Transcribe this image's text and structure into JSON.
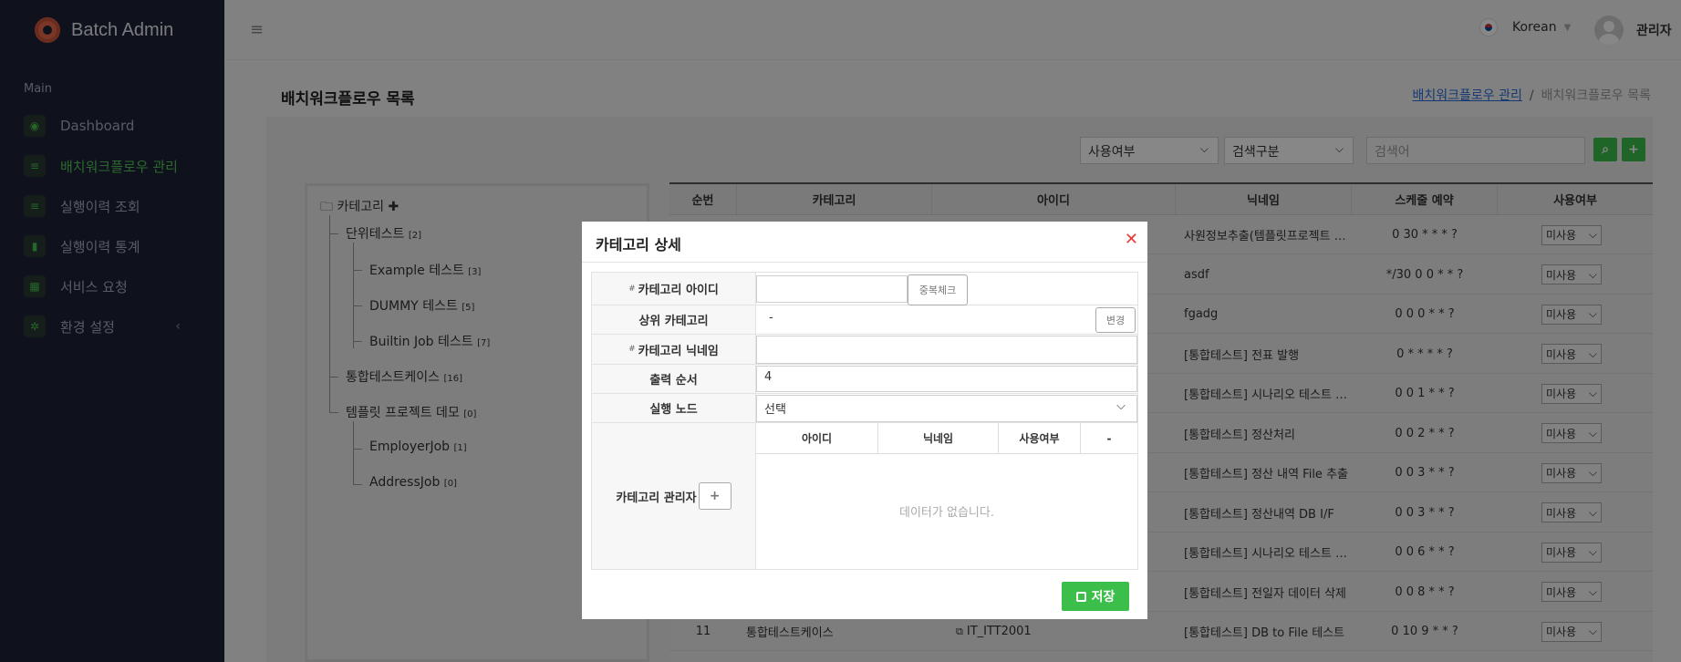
{
  "app": {
    "brand": "Batch Admin"
  },
  "sidebar": {
    "section": "Main",
    "items": [
      {
        "label": "Dashboard",
        "icon": "dashboard-icon"
      },
      {
        "label": "배치워크플로우 관리",
        "icon": "list-icon",
        "active": true
      },
      {
        "label": "실행이력 조회",
        "icon": "list-icon"
      },
      {
        "label": "실행이력 통계",
        "icon": "bar-chart-icon"
      },
      {
        "label": "서비스 요청",
        "icon": "grid-icon"
      },
      {
        "label": "환경 설정",
        "icon": "gear-icon"
      }
    ]
  },
  "header": {
    "language": "Korean",
    "user": "관리자"
  },
  "page": {
    "title": "배치워크플로우 목록",
    "breadcrumb": {
      "parent": "배치워크플로우 관리",
      "sep": "/",
      "current": "배치워크플로우 목록"
    }
  },
  "filters": {
    "use_select": "사용여부",
    "type_select": "검색구분",
    "search_placeholder": "검색어"
  },
  "tree": {
    "root": "카테고리",
    "nodes": [
      {
        "label": "단위테스트",
        "count": "[2]"
      },
      {
        "label": "Example 테스트",
        "count": "[3]"
      },
      {
        "label": "DUMMY 테스트",
        "count": "[5]"
      },
      {
        "label": "Builtin Job 테스트",
        "count": "[7]"
      },
      {
        "label": "통합테스트케이스",
        "count": "[16]"
      },
      {
        "label": "템플릿 프로젝트 데모",
        "count": "[0]"
      },
      {
        "label": "EmployerJob",
        "count": "[1]"
      },
      {
        "label": "AddressJob",
        "count": "[0]"
      }
    ]
  },
  "table": {
    "columns": [
      "순번",
      "카테고리",
      "아이디",
      "닉네임",
      "스케줄 예약",
      "사용여부"
    ],
    "rows": [
      {
        "nickname": "사원정보추출(템플릿프로젝트 …",
        "schedule": "0 30 * * * ?",
        "use": "미사용"
      },
      {
        "nickname": "asdf",
        "schedule": "*/30 0 0 * * ?",
        "use": "미사용"
      },
      {
        "nickname": "fgadg",
        "schedule": "0 0 0 * * ?",
        "use": "미사용"
      },
      {
        "nickname": "[통합테스트] 전표 발행",
        "schedule": "0 * * * * ?",
        "use": "미사용"
      },
      {
        "nickname": "[통합테스트] 시나리오 테스트 …",
        "schedule": "0 0 1 * * ?",
        "use": "미사용"
      },
      {
        "nickname": "[통합테스트] 정산처리",
        "schedule": "0 0 2 * * ?",
        "use": "미사용"
      },
      {
        "nickname": "[통합테스트] 정산 내역 File 추출",
        "schedule": "0 0 3 * * ?",
        "use": "미사용"
      },
      {
        "nickname": "[통합테스트] 정산내역 DB I/F",
        "schedule": "0 0 3 * * ?",
        "use": "미사용"
      },
      {
        "nickname": "[통합테스트] 시나리오 테스트 …",
        "schedule": "0 0 6 * * ?",
        "use": "미사용"
      },
      {
        "nickname": "[통합테스트] 전일자 데이터 삭제",
        "schedule": "0 0 8 * * ?",
        "use": "미사용"
      },
      {
        "no": "11",
        "category": "통합테스트케이스",
        "id": "IT_ITT2001",
        "nickname": "[통합테스트] DB to File 테스트",
        "schedule": "0 10 9 * * ?",
        "use": "미사용"
      }
    ]
  },
  "modal": {
    "title": "카테고리 상세",
    "fields": {
      "id_label": "카테고리 아이디",
      "id_value": "",
      "dup_check": "중복체크",
      "parent_label": "상위 카테고리",
      "parent_value": "-",
      "change": "변경",
      "nickname_label": "카테고리 닉네임",
      "nickname_value": "",
      "order_label": "출력 순서",
      "order_value": "4",
      "node_label": "실행 노드",
      "node_value": "선택",
      "manager_label": "카테고리 관리자"
    },
    "manager_table": {
      "columns": [
        "아이디",
        "닉네임",
        "사용여부",
        "-"
      ],
      "empty": "데이터가 없습니다."
    },
    "save": "저장"
  }
}
